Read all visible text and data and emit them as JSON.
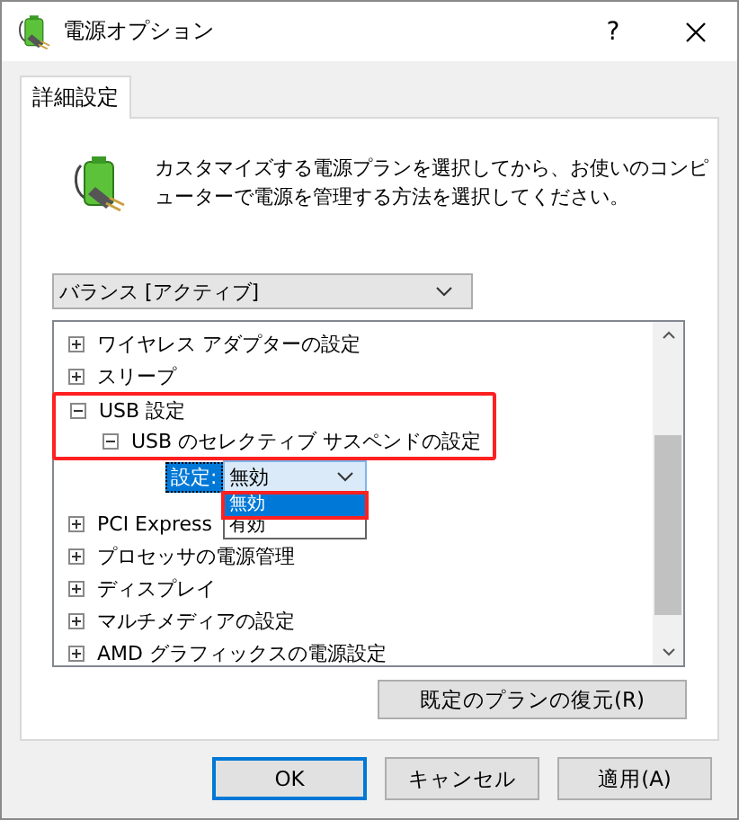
{
  "window": {
    "title": "電源オプション",
    "help": "?"
  },
  "tabs": [
    {
      "label": "詳細設定",
      "selected": true
    }
  ],
  "description": "カスタマイズする電源プランを選択してから、お使いのコンピューターで電源を管理する方法を選択してください。",
  "plan": {
    "value": "バランス [アクティブ]"
  },
  "tree": [
    {
      "kind": "group",
      "label": "ワイヤレス アダプターの設定",
      "expanded": false
    },
    {
      "kind": "group",
      "label": "スリープ",
      "expanded": false
    },
    {
      "kind": "group",
      "label": "USB 設定",
      "expanded": true,
      "highlighted": true,
      "children": [
        {
          "kind": "group",
          "label": "USB のセレクティブ サスペンドの設定",
          "expanded": true,
          "highlighted": true,
          "children": [
            {
              "kind": "setting",
              "label": "設定:",
              "value": "無効",
              "open": true,
              "options": [
                {
                  "label": "無効",
                  "selected": true,
                  "highlighted": true
                },
                {
                  "label": "有効",
                  "selected": false,
                  "highlighted": false
                }
              ]
            }
          ]
        }
      ]
    },
    {
      "kind": "group",
      "label": "PCI Express",
      "expanded": false
    },
    {
      "kind": "group",
      "label": "プロセッサの電源管理",
      "expanded": false
    },
    {
      "kind": "group",
      "label": "ディスプレイ",
      "expanded": false
    },
    {
      "kind": "group",
      "label": "マルチメディアの設定",
      "expanded": false
    },
    {
      "kind": "group",
      "label": "AMD グラフィックスの電源設定",
      "expanded": false
    }
  ],
  "restore_button": "既定のプランの復元(R)",
  "buttons": [
    {
      "label": "OK",
      "default": true
    },
    {
      "label": "キャンセル",
      "default": false
    },
    {
      "label": "適用(A)",
      "default": false
    }
  ]
}
